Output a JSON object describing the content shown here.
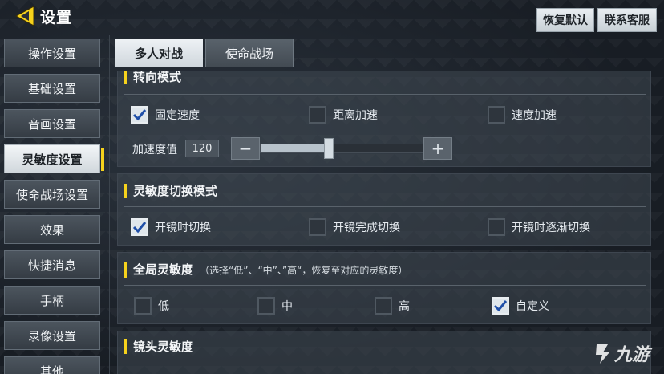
{
  "header": {
    "title": "设置",
    "restore_default": "恢复默认",
    "contact_support": "联系客服"
  },
  "sidebar": {
    "items": [
      {
        "label": "操作设置",
        "active": false
      },
      {
        "label": "基础设置",
        "active": false
      },
      {
        "label": "音画设置",
        "active": false
      },
      {
        "label": "灵敏度设置",
        "active": true
      },
      {
        "label": "使命战场设置",
        "active": false
      },
      {
        "label": "效果",
        "active": false
      },
      {
        "label": "快捷消息",
        "active": false
      },
      {
        "label": "手柄",
        "active": false
      },
      {
        "label": "录像设置",
        "active": false
      },
      {
        "label": "其他",
        "active": false
      }
    ]
  },
  "tabs": [
    {
      "label": "多人对战",
      "active": true
    },
    {
      "label": "使命战场",
      "active": false
    }
  ],
  "sections": {
    "turn_mode": {
      "title": "转向模式",
      "options": [
        {
          "label": "固定速度",
          "checked": true
        },
        {
          "label": "距离加速",
          "checked": false
        },
        {
          "label": "速度加速",
          "checked": false
        }
      ],
      "slider": {
        "label": "加速度值",
        "value": "120",
        "fraction": 0.42,
        "minus": "−",
        "plus": "+"
      }
    },
    "switch_mode": {
      "title": "灵敏度切换模式",
      "options": [
        {
          "label": "开镜时切换",
          "checked": true
        },
        {
          "label": "开镜完成切换",
          "checked": false
        },
        {
          "label": "开镜时逐渐切换",
          "checked": false
        }
      ]
    },
    "global": {
      "title": "全局灵敏度",
      "hint": "（选择“低”、“中”、”高“，恢复至对应的灵敏度）",
      "options": [
        {
          "label": "低",
          "checked": false
        },
        {
          "label": "中",
          "checked": false
        },
        {
          "label": "高",
          "checked": false
        },
        {
          "label": "自定义",
          "checked": true
        }
      ]
    },
    "lens": {
      "title": "镜头灵敏度"
    }
  },
  "watermark": {
    "text": "九游"
  },
  "colors": {
    "accent": "#f6d21c",
    "panel": "#404852",
    "check": "#1f4fa8"
  }
}
